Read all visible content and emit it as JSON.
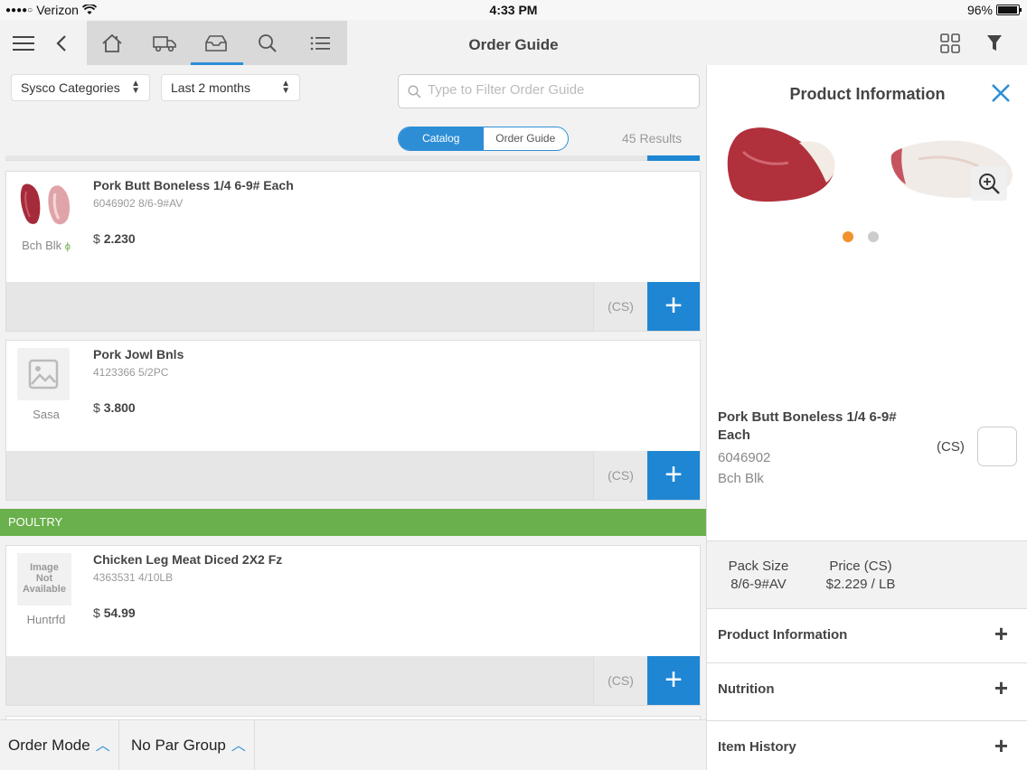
{
  "status_bar": {
    "carrier": "Verizon",
    "time": "4:33 PM",
    "battery": "96%"
  },
  "header": {
    "title": "Order Guide"
  },
  "filters": {
    "category_select": "Sysco Categories",
    "date_select": "Last 2 months",
    "search_placeholder": "Type to Filter Order Guide"
  },
  "view_toggle": {
    "catalog_label": "Catalog",
    "order_guide_label": "Order Guide",
    "results": "45 Results"
  },
  "products": [
    {
      "name": "Pork Butt Boneless 1/4 6-9# Each",
      "code": "6046902 8/6-9#AV",
      "brand": "Bch Blk",
      "currency": "$",
      "price": "2.230",
      "unit": "(CS)"
    },
    {
      "name": "Pork Jowl Bnls",
      "code": "4123366 5/2PC",
      "brand": "Sasa",
      "currency": "$",
      "price": "3.800",
      "unit": "(CS)"
    },
    {
      "name": "Chicken Leg Meat Diced 2X2 Fz",
      "code": "4363531 4/10LB",
      "brand": "Huntrfd",
      "currency": "$",
      "price": "54.99",
      "unit": "(CS)",
      "image_text": [
        "Image",
        "Not",
        "Available"
      ]
    }
  ],
  "category_header": "POULTRY",
  "bottom_bar": {
    "order_mode": "Order Mode",
    "par_group": "No Par Group"
  },
  "detail_panel": {
    "title": "Product Information",
    "product_name": "Pork Butt Boneless 1/4 6-9# Each",
    "product_code": "6046902",
    "brand": "Bch Blk",
    "unit": "(CS)",
    "pack_size_label": "Pack Size",
    "pack_size_value": "8/6-9#AV",
    "price_label": "Price (CS)",
    "price_value": "$2.229 / LB",
    "sections": [
      "Product Information",
      "Nutrition",
      "Item History"
    ],
    "image_index": 0,
    "image_count": 2
  },
  "colors": {
    "accent_blue": "#1f86d3",
    "category_green": "#6ab04c",
    "dot_active": "#f0922d"
  }
}
